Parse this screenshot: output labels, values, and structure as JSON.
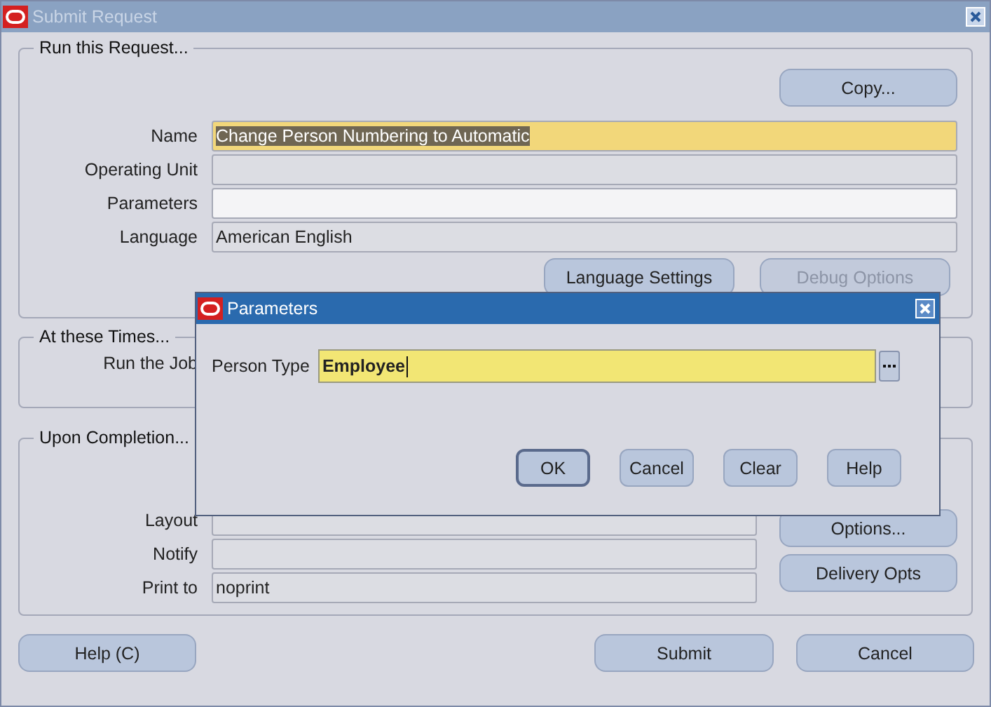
{
  "window": {
    "title": "Submit Request",
    "active": false
  },
  "run_request": {
    "legend": "Run this Request...",
    "copy_button": "Copy...",
    "fields": [
      {
        "label": "Name",
        "value": "Change Person Numbering to Automatic",
        "kind": "current"
      },
      {
        "label": "Operating Unit",
        "kind": "readonly"
      },
      {
        "label": "Parameters",
        "kind": "enterable"
      },
      {
        "label": "Language",
        "value": "American English",
        "kind": "readonly"
      }
    ],
    "buttons": [
      {
        "label": "Language Settings",
        "disabled": false
      },
      {
        "label": "Debug Options",
        "disabled": true
      }
    ]
  },
  "times": {
    "legend": "At these Times...",
    "label": "Run the Job"
  },
  "completion": {
    "legend": "Upon Completion...",
    "fields": [
      {
        "label": "Layout"
      },
      {
        "label": "Notify"
      },
      {
        "label": "Print to",
        "value": "noprint"
      }
    ],
    "buttons": [
      "Options...",
      "Delivery Opts"
    ]
  },
  "help_button": "Help (C)",
  "footer_buttons": [
    "Submit",
    "Cancel"
  ],
  "dialog": {
    "title": "Parameters",
    "active": true,
    "field": {
      "label": "Person Type",
      "value": "Employee"
    },
    "buttons": [
      {
        "label": "OK",
        "default": true
      },
      {
        "label": "Cancel",
        "default": false
      },
      {
        "label": "Clear",
        "default": false
      },
      {
        "label": "Help",
        "default": false
      }
    ]
  }
}
